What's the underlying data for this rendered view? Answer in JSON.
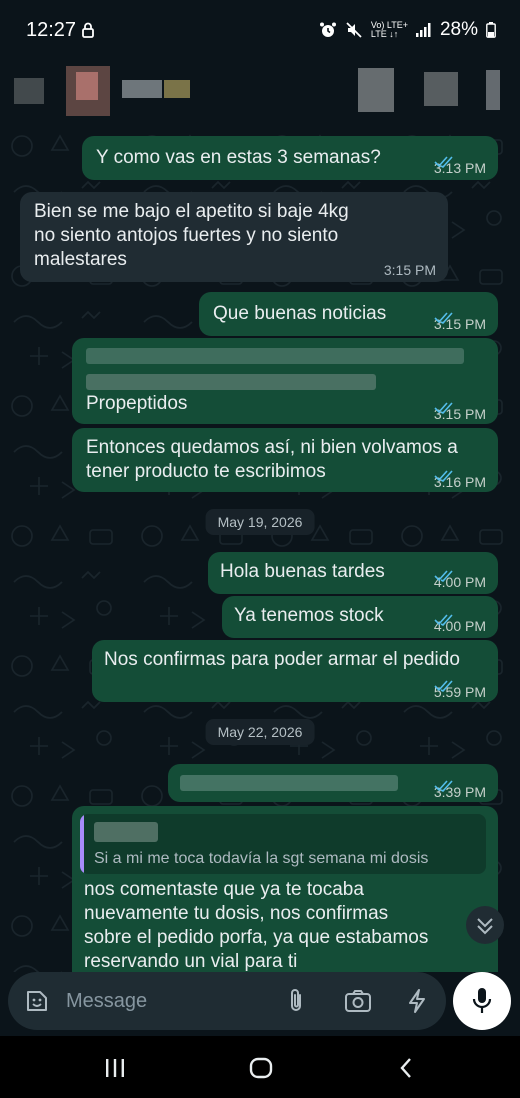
{
  "status_bar": {
    "time": "12:27",
    "network_top": "Vo) LTE+",
    "network_bottom": "LTE ↓↑",
    "battery": "28%"
  },
  "messages": [
    {
      "dir": "out",
      "text": "Y como vas en estas 3 semanas?",
      "time": "3:13 PM",
      "read": true
    },
    {
      "dir": "in",
      "lines": [
        "Bien se me bajo el apetito si baje 4kg",
        "no siento antojos fuertes y no siento",
        "malestares"
      ],
      "time": "3:15 PM"
    },
    {
      "dir": "out",
      "text": "Que buenas noticias",
      "time": "3:15 PM",
      "read": true
    },
    {
      "dir": "out",
      "visible_text": "Propeptidos",
      "time": "3:15 PM",
      "read": true
    },
    {
      "dir": "out",
      "lines": [
        "Entonces quedamos así, ni bien volvamos a",
        "tener producto te escribimos"
      ],
      "time": "3:16 PM",
      "read": true
    },
    {
      "dir": "out",
      "text": "Hola buenas tardes",
      "time": "4:00 PM",
      "read": true
    },
    {
      "dir": "out",
      "text": "Ya tenemos stock",
      "time": "4:00 PM",
      "read": true
    },
    {
      "dir": "out",
      "text": "Nos confirmas para poder armar el pedido",
      "time": "5:59 PM",
      "read": true
    },
    {
      "dir": "out",
      "time": "3:39 PM",
      "read": true
    },
    {
      "dir": "out",
      "quoted_text": "Si a mi me toca todavía la sgt semana mi dosis",
      "lines": [
        "nos comentaste que ya te tocaba",
        "nuevamente tu dosis, nos confirmas",
        "sobre el pedido porfa, ya que estabamos",
        "reservando un vial para ti"
      ]
    }
  ],
  "date_separators": [
    "May 19, 2026",
    "May 22, 2026"
  ],
  "composer": {
    "placeholder": "Message"
  },
  "icons": [
    "lock-icon",
    "alarm-icon",
    "mute-icon",
    "signal-icon",
    "battery-icon",
    "sticker-icon",
    "attach-icon",
    "camera-icon",
    "bolt-icon",
    "mic-icon",
    "scroll-down-icon",
    "recents-icon",
    "home-icon",
    "back-icon",
    "double-check-icon"
  ],
  "colors": {
    "background": "#0b141a",
    "outgoing_bubble": "#144d37",
    "incoming_bubble": "#202c33",
    "read_ticks": "#53bdeb",
    "quote_bar": "#a78bfa"
  }
}
